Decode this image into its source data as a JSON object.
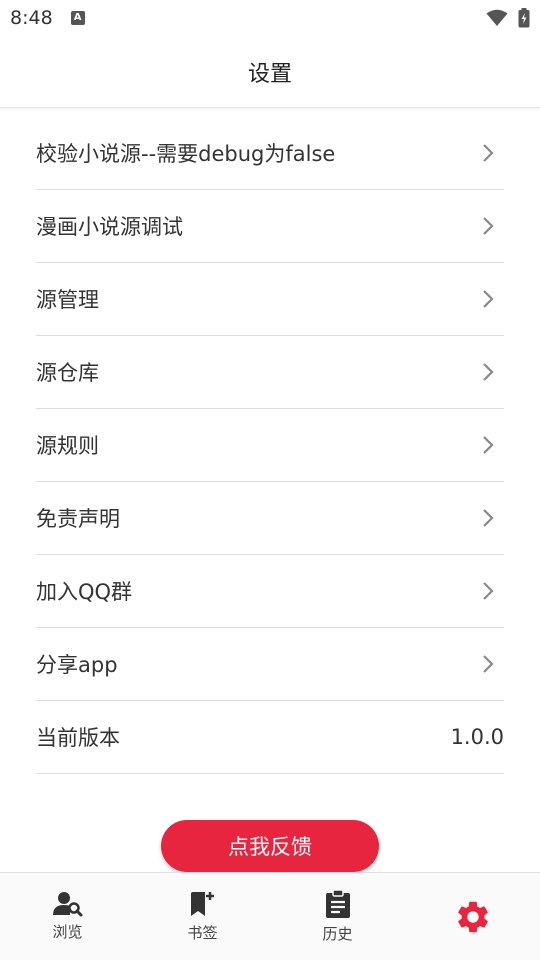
{
  "status_bar": {
    "time": "8:48",
    "notification_letter": "A"
  },
  "app_bar": {
    "title": "设置"
  },
  "settings": {
    "items": [
      {
        "label": "校验小说源--需要debug为false"
      },
      {
        "label": "漫画小说源调试"
      },
      {
        "label": "源管理"
      },
      {
        "label": "源仓库"
      },
      {
        "label": "源规则"
      },
      {
        "label": "免责声明"
      },
      {
        "label": "加入QQ群"
      },
      {
        "label": "分享app"
      }
    ],
    "version": {
      "label": "当前版本",
      "value": "1.0.0"
    }
  },
  "feedback": {
    "label": "点我反馈",
    "color": "#e8253f"
  },
  "bottom_nav": {
    "items": [
      {
        "label": "浏览",
        "icon": "browse-person-search-icon"
      },
      {
        "label": "书签",
        "icon": "bookmark-add-icon"
      },
      {
        "label": "历史",
        "icon": "clipboard-history-icon"
      },
      {
        "label": "",
        "icon": "gear-icon",
        "active": true
      }
    ],
    "active_color": "#e8253f"
  }
}
